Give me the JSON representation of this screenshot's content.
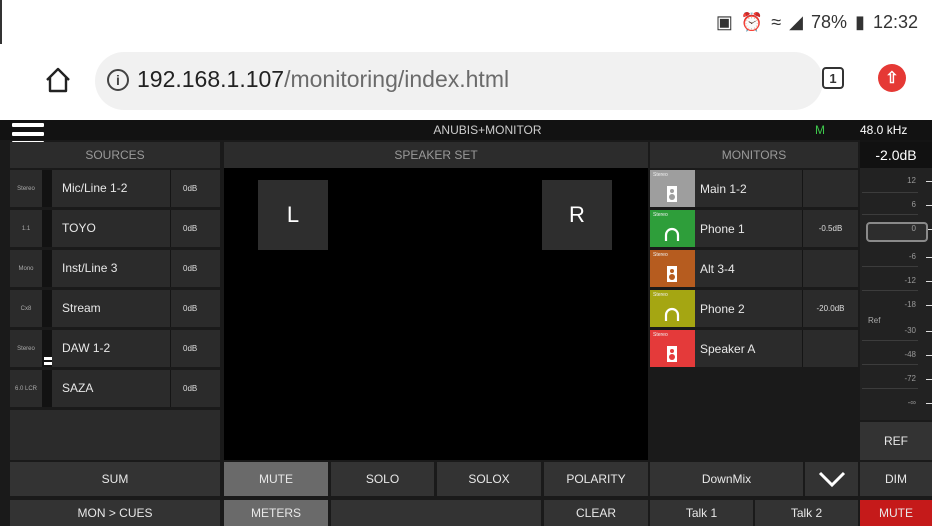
{
  "status_bar": {
    "battery": "78%",
    "time": "12:32"
  },
  "browser": {
    "url_host": "192.168.1.107",
    "url_path": "/monitoring/index.html",
    "tab_count": "1"
  },
  "app": {
    "title": "ANUBIS+MONITOR",
    "mode_indicator": "M",
    "sample_rate": "48.0 kHz",
    "main_gain": "-2.0dB",
    "headers": {
      "sources": "SOURCES",
      "speaker_set": "SPEAKER SET",
      "monitors": "MONITORS"
    }
  },
  "sources": [
    {
      "tag": "Stereo",
      "name": "Mic/Line 1-2",
      "gain": "0dB"
    },
    {
      "tag": "1.1",
      "name": "TOYO",
      "gain": "0dB"
    },
    {
      "tag": "Mono",
      "name": "Inst/Line 3",
      "gain": "0dB"
    },
    {
      "tag": "Cx8",
      "name": "Stream",
      "gain": "0dB"
    },
    {
      "tag": "Stereo",
      "name": "DAW 1-2",
      "gain": "0dB"
    },
    {
      "tag": "6.0 LCR",
      "name": "SAZA",
      "gain": "0dB"
    }
  ],
  "speakers": {
    "left": "L",
    "right": "R"
  },
  "monitors": [
    {
      "tag": "Stereo",
      "name": "Main 1-2",
      "gain": "",
      "color": "#9e9e9e",
      "icon": "speaker-icon"
    },
    {
      "tag": "Stereo",
      "name": "Phone 1",
      "gain": "-0.5dB",
      "color": "#2e9e3a",
      "icon": "headphones-icon"
    },
    {
      "tag": "Stereo",
      "name": "Alt 3-4",
      "gain": "",
      "color": "#b65c1f",
      "icon": "speaker-icon"
    },
    {
      "tag": "Stereo",
      "name": "Phone 2",
      "gain": "-20.0dB",
      "color": "#a5a612",
      "icon": "headphones-icon"
    },
    {
      "tag": "Stereo",
      "name": "Speaker A",
      "gain": "",
      "color": "#e43a3a",
      "icon": "speaker-icon"
    }
  ],
  "meter": {
    "ticks": [
      "12",
      "6",
      "0",
      "-6",
      "-12",
      "-18",
      "-30",
      "-48",
      "-72",
      "-∞"
    ],
    "ref_label": "Ref"
  },
  "buttons": {
    "sum": "SUM",
    "mon_cues": "MON > CUES",
    "mute": "MUTE",
    "solo": "SOLO",
    "solox": "SOLOX",
    "polarity": "POLARITY",
    "meters": "METERS",
    "clear": "CLEAR",
    "downmix": "DownMix",
    "talk1": "Talk 1",
    "talk2": "Talk 2",
    "ref": "REF",
    "dim": "DIM",
    "main_mute": "MUTE"
  }
}
